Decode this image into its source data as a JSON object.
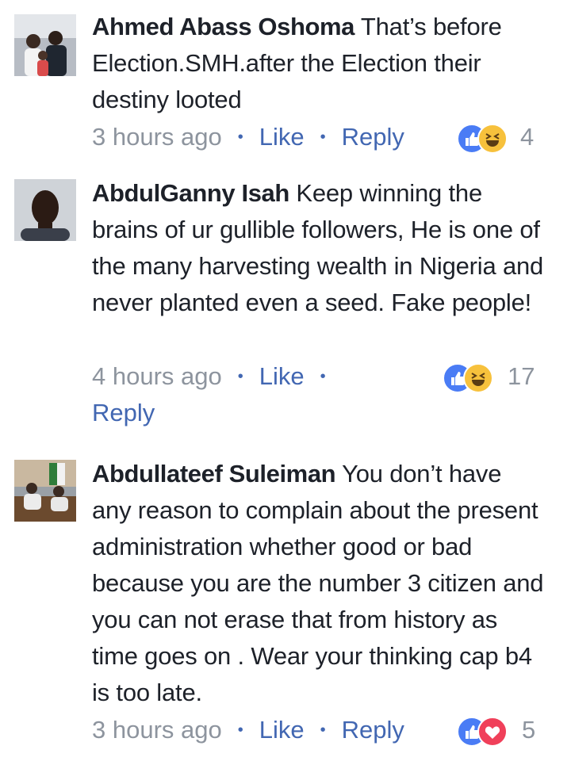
{
  "comments": [
    {
      "author": "Ahmed Abass Oshoma",
      "text": "That’s before Election.SMH.after the Election their destiny looted",
      "time": "3 hours ago",
      "like_label": "Like",
      "reply_label": "Reply",
      "reactions": [
        "like-icon",
        "haha-icon"
      ],
      "reaction_count": "4"
    },
    {
      "author": "AbdulGanny Isah",
      "text": "Keep winning the brains of ur gullible followers, He is one of the many harvesting wealth in Nigeria and never planted even a seed. Fake people!",
      "time": "4 hours ago",
      "like_label": "Like",
      "reply_label": "Reply",
      "reactions": [
        "like-icon",
        "haha-icon"
      ],
      "reaction_count": "17"
    },
    {
      "author": "Abdullateef Suleiman",
      "text": "You don’t have any reason to complain about the present administration whether good or bad because you are the number 3 citizen and you can not erase that from history as time goes on . Wear your thinking cap b4 is too late.",
      "time": "3 hours ago",
      "like_label": "Like",
      "reply_label": "Reply",
      "reactions": [
        "like-icon",
        "love-icon"
      ],
      "reaction_count": "5"
    }
  ],
  "colors": {
    "link": "#4267b2",
    "meta": "#8d949e",
    "text": "#1d2129",
    "like": "#4a7cf5",
    "haha": "#f7c13c",
    "love": "#f0405a"
  }
}
